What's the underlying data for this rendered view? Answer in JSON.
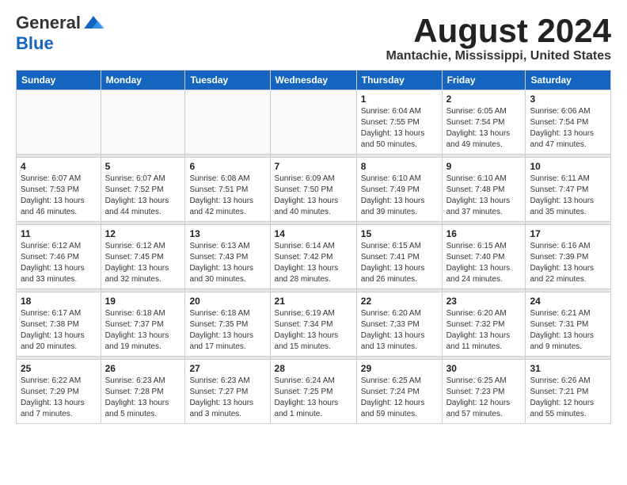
{
  "logo": {
    "general": "General",
    "blue": "Blue"
  },
  "header": {
    "month_year": "August 2024",
    "location": "Mantachie, Mississippi, United States"
  },
  "weekdays": [
    "Sunday",
    "Monday",
    "Tuesday",
    "Wednesday",
    "Thursday",
    "Friday",
    "Saturday"
  ],
  "weeks": [
    [
      {
        "day": "",
        "info": ""
      },
      {
        "day": "",
        "info": ""
      },
      {
        "day": "",
        "info": ""
      },
      {
        "day": "",
        "info": ""
      },
      {
        "day": "1",
        "info": "Sunrise: 6:04 AM\nSunset: 7:55 PM\nDaylight: 13 hours\nand 50 minutes."
      },
      {
        "day": "2",
        "info": "Sunrise: 6:05 AM\nSunset: 7:54 PM\nDaylight: 13 hours\nand 49 minutes."
      },
      {
        "day": "3",
        "info": "Sunrise: 6:06 AM\nSunset: 7:54 PM\nDaylight: 13 hours\nand 47 minutes."
      }
    ],
    [
      {
        "day": "4",
        "info": "Sunrise: 6:07 AM\nSunset: 7:53 PM\nDaylight: 13 hours\nand 46 minutes."
      },
      {
        "day": "5",
        "info": "Sunrise: 6:07 AM\nSunset: 7:52 PM\nDaylight: 13 hours\nand 44 minutes."
      },
      {
        "day": "6",
        "info": "Sunrise: 6:08 AM\nSunset: 7:51 PM\nDaylight: 13 hours\nand 42 minutes."
      },
      {
        "day": "7",
        "info": "Sunrise: 6:09 AM\nSunset: 7:50 PM\nDaylight: 13 hours\nand 40 minutes."
      },
      {
        "day": "8",
        "info": "Sunrise: 6:10 AM\nSunset: 7:49 PM\nDaylight: 13 hours\nand 39 minutes."
      },
      {
        "day": "9",
        "info": "Sunrise: 6:10 AM\nSunset: 7:48 PM\nDaylight: 13 hours\nand 37 minutes."
      },
      {
        "day": "10",
        "info": "Sunrise: 6:11 AM\nSunset: 7:47 PM\nDaylight: 13 hours\nand 35 minutes."
      }
    ],
    [
      {
        "day": "11",
        "info": "Sunrise: 6:12 AM\nSunset: 7:46 PM\nDaylight: 13 hours\nand 33 minutes."
      },
      {
        "day": "12",
        "info": "Sunrise: 6:12 AM\nSunset: 7:45 PM\nDaylight: 13 hours\nand 32 minutes."
      },
      {
        "day": "13",
        "info": "Sunrise: 6:13 AM\nSunset: 7:43 PM\nDaylight: 13 hours\nand 30 minutes."
      },
      {
        "day": "14",
        "info": "Sunrise: 6:14 AM\nSunset: 7:42 PM\nDaylight: 13 hours\nand 28 minutes."
      },
      {
        "day": "15",
        "info": "Sunrise: 6:15 AM\nSunset: 7:41 PM\nDaylight: 13 hours\nand 26 minutes."
      },
      {
        "day": "16",
        "info": "Sunrise: 6:15 AM\nSunset: 7:40 PM\nDaylight: 13 hours\nand 24 minutes."
      },
      {
        "day": "17",
        "info": "Sunrise: 6:16 AM\nSunset: 7:39 PM\nDaylight: 13 hours\nand 22 minutes."
      }
    ],
    [
      {
        "day": "18",
        "info": "Sunrise: 6:17 AM\nSunset: 7:38 PM\nDaylight: 13 hours\nand 20 minutes."
      },
      {
        "day": "19",
        "info": "Sunrise: 6:18 AM\nSunset: 7:37 PM\nDaylight: 13 hours\nand 19 minutes."
      },
      {
        "day": "20",
        "info": "Sunrise: 6:18 AM\nSunset: 7:35 PM\nDaylight: 13 hours\nand 17 minutes."
      },
      {
        "day": "21",
        "info": "Sunrise: 6:19 AM\nSunset: 7:34 PM\nDaylight: 13 hours\nand 15 minutes."
      },
      {
        "day": "22",
        "info": "Sunrise: 6:20 AM\nSunset: 7:33 PM\nDaylight: 13 hours\nand 13 minutes."
      },
      {
        "day": "23",
        "info": "Sunrise: 6:20 AM\nSunset: 7:32 PM\nDaylight: 13 hours\nand 11 minutes."
      },
      {
        "day": "24",
        "info": "Sunrise: 6:21 AM\nSunset: 7:31 PM\nDaylight: 13 hours\nand 9 minutes."
      }
    ],
    [
      {
        "day": "25",
        "info": "Sunrise: 6:22 AM\nSunset: 7:29 PM\nDaylight: 13 hours\nand 7 minutes."
      },
      {
        "day": "26",
        "info": "Sunrise: 6:23 AM\nSunset: 7:28 PM\nDaylight: 13 hours\nand 5 minutes."
      },
      {
        "day": "27",
        "info": "Sunrise: 6:23 AM\nSunset: 7:27 PM\nDaylight: 13 hours\nand 3 minutes."
      },
      {
        "day": "28",
        "info": "Sunrise: 6:24 AM\nSunset: 7:25 PM\nDaylight: 13 hours\nand 1 minute."
      },
      {
        "day": "29",
        "info": "Sunrise: 6:25 AM\nSunset: 7:24 PM\nDaylight: 12 hours\nand 59 minutes."
      },
      {
        "day": "30",
        "info": "Sunrise: 6:25 AM\nSunset: 7:23 PM\nDaylight: 12 hours\nand 57 minutes."
      },
      {
        "day": "31",
        "info": "Sunrise: 6:26 AM\nSunset: 7:21 PM\nDaylight: 12 hours\nand 55 minutes."
      }
    ]
  ]
}
